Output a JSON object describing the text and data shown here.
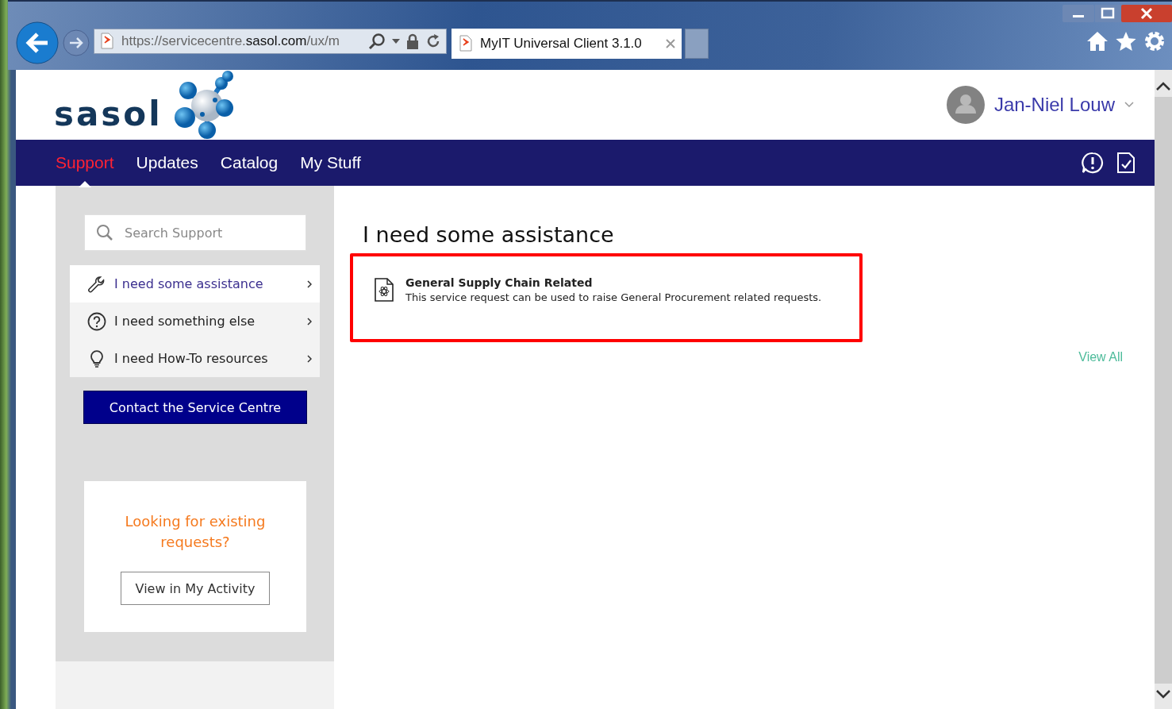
{
  "browser": {
    "address": {
      "prefix": "https://servicecentre.",
      "domain": "sasol.com",
      "suffix": "/ux/m"
    },
    "tab_title": "MyIT Universal Client 3.1.0"
  },
  "header": {
    "logo_text": "sasol",
    "user_name": "Jan-Niel Louw"
  },
  "nav": [
    {
      "label": "Support",
      "selected": true
    },
    {
      "label": "Updates",
      "selected": false
    },
    {
      "label": "Catalog",
      "selected": false
    },
    {
      "label": "My Stuff",
      "selected": false
    }
  ],
  "sidebar": {
    "search": {
      "placeholder": "Search Support"
    },
    "items": [
      {
        "label": "I need some assistance",
        "kind": "wrench",
        "selected": true
      },
      {
        "label": "I need something else",
        "kind": "question",
        "selected": false
      },
      {
        "label": "I need How-To resources",
        "kind": "bulb",
        "selected": false
      }
    ],
    "contact_button": "Contact the Service Centre",
    "promo": {
      "text": "Looking for existing requests?",
      "button": "View in My Activity"
    }
  },
  "main": {
    "heading": "I need some assistance",
    "cards": [
      {
        "title": "General Supply Chain Related",
        "description": "This service request can be used to raise General Procurement related requests.",
        "highlighted": true
      }
    ],
    "view_all": "View All"
  }
}
